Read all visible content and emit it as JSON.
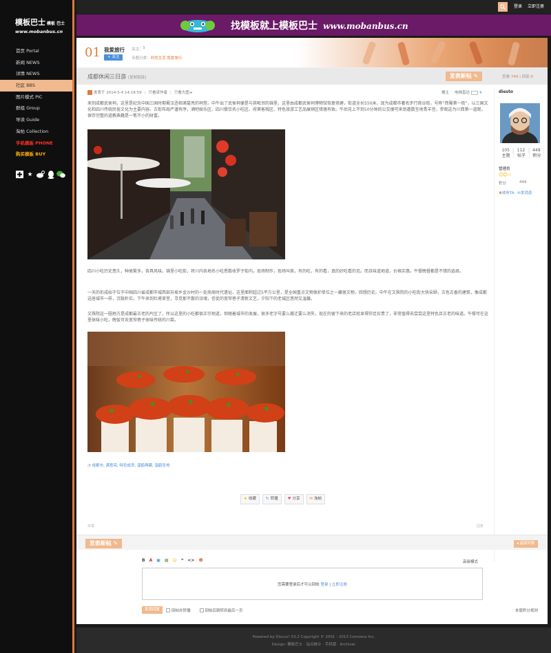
{
  "site": {
    "logo_main": "模板巴士",
    "logo_small": "模板\n巴士",
    "logo_url": "www.mobanbus.cn"
  },
  "nav": [
    {
      "label": "首页 Portal",
      "style": "normal"
    },
    {
      "label": "新闻 NEWS",
      "style": "normal"
    },
    {
      "label": "详情 NEWS",
      "style": "normal"
    },
    {
      "label": "社区 BBS",
      "style": "active"
    },
    {
      "label": "图片模式 PIC",
      "style": "normal"
    },
    {
      "label": "群组 Group",
      "style": "normal"
    },
    {
      "label": "导读 Guide",
      "style": "normal"
    },
    {
      "label": "淘帖 Collection",
      "style": "normal"
    },
    {
      "label": "手机模板 PHONE",
      "style": "red"
    },
    {
      "label": "购买模板 BUY",
      "style": "orange"
    }
  ],
  "topbar": {
    "login": "登录",
    "register": "立即注册"
  },
  "banner": {
    "slogan": "找模板就上模板巴士",
    "url": "www.mobanbus.cn"
  },
  "forum": {
    "number": "01",
    "name": "我爱旅行",
    "follow_label": "关注：",
    "follow_count": "3",
    "follow_button": "+ 关注",
    "related_label": "专题分类：",
    "related_links": "时尚生活 我爱旅行"
  },
  "thread": {
    "title": "成都休闲三日游",
    "copy_link": "[复制链接]",
    "post_button": "发表新帖",
    "views_label": "查看:",
    "views": "749",
    "replies_label": "回复:",
    "replies": "0"
  },
  "post": {
    "posted_at": "发表于 2014-5-4 14:18:59",
    "only_author": "只看该作者",
    "view_large": "只看大图",
    "floor": "楼主",
    "electric": "电梯直达",
    "para1": "来到成都武侯祠，这里是纪念中国三国时期蜀汉丞相诸葛亮的祠堂。中午出了武侯祠便是与其毗邻的锦里，这里由成都武侯祠博物馆恢复修建，街道全长550米，现为成都市著名步行商业街，号称“西蜀第一街”，以三国文化和四川传统民俗文化为主要内容。古街布局严谨有序，酒吧娱乐区、四川餐饮名小吃区、府第客栈区、特色旅游工艺品展销区错落有致。午后花上不到10分钟的公交便可来到邀数至地青羊宫，参观这为川西第一道观，保存完整的道教典籍是一笔不小的财富。",
    "para2": "四川小吃历史悠久，种类繁多，各具风味。锦里小吃街，将川内各地名小吃悉数收罗于街内，现场制作，现场叫卖，有的吃，有的看，真的好吃看的见。而且味道地道，价格实惠。午餐晚餐都是不错的选择。",
    "para3": "一天的形成始于位于中国四川省成都市城西部苏坡乡金沙村的一处商周时代遗址，这里面积超过5平方公里，是全国重点文物保护单位之一藏很文物，回想历史。中午在文殊院的小吃街大快朵颐，古色古香的建筑，像成都这座城市一样，沉稳朴实。下午来到杜甫草堂，寻觅那不散的诗魂，信徒的宽窄巷子清新文艺，夕阳下的老城区悠然又温馨。",
    "para4": "文殊院这一圈地方是成都最古老的片区了，所以这里的小吃都很正宗地道，但随着城市的发展，很多老字号要么搬迁要么消失，现在的留下来的老店就显得弥足珍贵了，非常值得去尝尝这里特色且古老的味道。午餐可在这里体味小吃，晚饭可去宽窄巷子体味传统的川菜。",
    "tags": "成都市, 满意亮, 特色成员, 温鹤典藏, 温鹤圣地",
    "actions": [
      {
        "icon": "★",
        "label": "收藏"
      },
      {
        "icon": "↻",
        "label": "转播"
      },
      {
        "icon": "♥",
        "label": "分享"
      },
      {
        "icon": "✉",
        "label": "淘帖"
      }
    ],
    "foot_left": "举报",
    "foot_right": "回复"
  },
  "author": {
    "name": "diesto",
    "counts": [
      {
        "value": "105",
        "label": "主题"
      },
      {
        "value": "112",
        "label": "帖子"
      },
      {
        "value": "449",
        "label": "积分"
      }
    ],
    "group": "管理员",
    "stars": "☺☺☆",
    "score_label": "积分",
    "score_value": "449",
    "link_favorite": "收听TA",
    "link_message": "发消息"
  },
  "reply": {
    "post_button": "发表新帖",
    "back_button": "返回列表",
    "toolbar": [
      "B",
      "A",
      "▣",
      "▦",
      "☺",
      "❝",
      "<>",
      "☻"
    ],
    "mode": "高级模式",
    "login_msg": "您需要登录后才可以回帖",
    "login_link": "登录",
    "register_link": "立即注册",
    "submit": "发表回复",
    "opt1": "回帖并转播",
    "opt2": "回帖后跳转到最后一页",
    "rules": "本版积分规则"
  },
  "footer": {
    "line1": "Powered by Discuz! X3.2  Copyright © 2001 - 2013 Comsenz Inc.",
    "line2": "Design: 模板巴士 · 站点统计 · 手机版 · Archiver"
  },
  "colors": {
    "accent": "#e07a3c",
    "accent_light": "#f1b98e",
    "banner": "#6a1a66",
    "link": "#4a90d9"
  }
}
